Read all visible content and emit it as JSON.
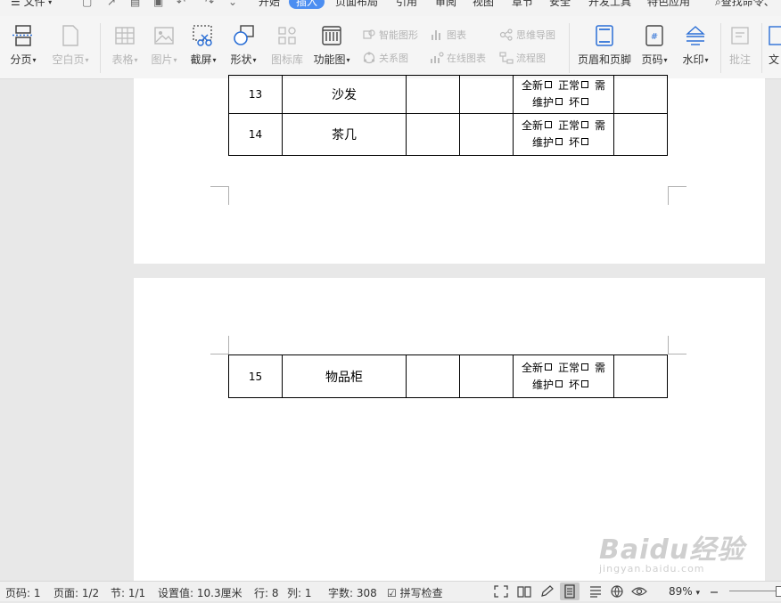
{
  "menu": {
    "file": "文件",
    "tabs": [
      "开始",
      "插入",
      "页面布局",
      "引用",
      "审阅",
      "视图",
      "章节",
      "安全",
      "开发工具",
      "特色应用"
    ],
    "active_tab": "插入",
    "search": "查找命令、"
  },
  "ribbon": {
    "page_break": "分页",
    "blank_page": "空白页",
    "table": "表格",
    "picture": "图片",
    "screenshot": "截屏",
    "shape": "形状",
    "icon_lib": "图标库",
    "func_chart": "功能图",
    "smart_shape": "智能图形",
    "chart": "图表",
    "mind_map": "思维导图",
    "relation": "关系图",
    "online_chart": "在线图表",
    "flowchart": "流程图",
    "header_footer": "页眉和页脚",
    "page_number": "页码",
    "watermark": "水印",
    "comment": "批注",
    "text": "文"
  },
  "document": {
    "rows": [
      {
        "num": "13",
        "name": "沙发",
        "status_line1": [
          "全新",
          "正常",
          "需"
        ],
        "status_line2": [
          "维护",
          "坏"
        ]
      },
      {
        "num": "14",
        "name": "茶几",
        "status_line1": [
          "全新",
          "正常",
          "需"
        ],
        "status_line2": [
          "维护",
          "坏"
        ]
      },
      {
        "num": "15",
        "name": "物品柜",
        "status_line1": [
          "全新",
          "正常",
          "需"
        ],
        "status_line2": [
          "维护",
          "坏"
        ]
      }
    ]
  },
  "status": {
    "page_no": "页码: 1",
    "pages": "页面: 1/2",
    "section": "节: 1/1",
    "setting": "设置值: 10.3厘米",
    "row": "行: 8",
    "col": "列: 1",
    "words": "字数: 308",
    "spell": "拼写检查",
    "zoom": "89%"
  },
  "watermark": {
    "brand": "Baidu经验",
    "url": "jingyan.baidu.com"
  },
  "colors": {
    "accent": "#4c8ef1",
    "icon_blue": "#2b6fd6"
  }
}
